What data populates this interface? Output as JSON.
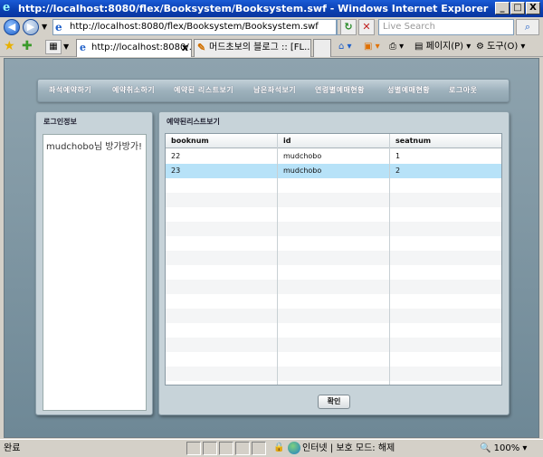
{
  "window": {
    "title": "http://localhost:8080/flex/Booksystem/Booksystem.swf - Windows Internet Explorer",
    "min": "_",
    "max": "□",
    "close": "X"
  },
  "address_bar": {
    "url": "http://localhost:8080/flex/Booksystem/Booksystem.swf",
    "search_placeholder": "Live Search"
  },
  "tabs": [
    {
      "label": "http://localhost:8080/..."
    },
    {
      "label": "머드초보의 블로그 :: [FL..."
    }
  ],
  "commands": {
    "page": "페이지(P)",
    "tools": "도구(O)"
  },
  "app": {
    "menu": [
      "좌석예약하기",
      "예약취소하기",
      "예약된 리스트보기",
      "남은좌석보기",
      "연령별예매현황",
      "성별예매현황",
      "로그아웃"
    ],
    "login_panel": {
      "title": "로그인정보",
      "message": "mudchobo님 방가방가!"
    },
    "reservation_panel": {
      "title": "예약된리스트보기",
      "columns": [
        "booknum",
        "id",
        "seatnum"
      ],
      "rows": [
        [
          "22",
          "mudchobo",
          "1"
        ],
        [
          "23",
          "mudchobo",
          "2"
        ]
      ],
      "selected_row": 1,
      "ok_button": "확인"
    }
  },
  "statusbar": {
    "text": "완료",
    "zone": "인터넷 | 보호 모드: 해제",
    "zoom": "100%"
  }
}
